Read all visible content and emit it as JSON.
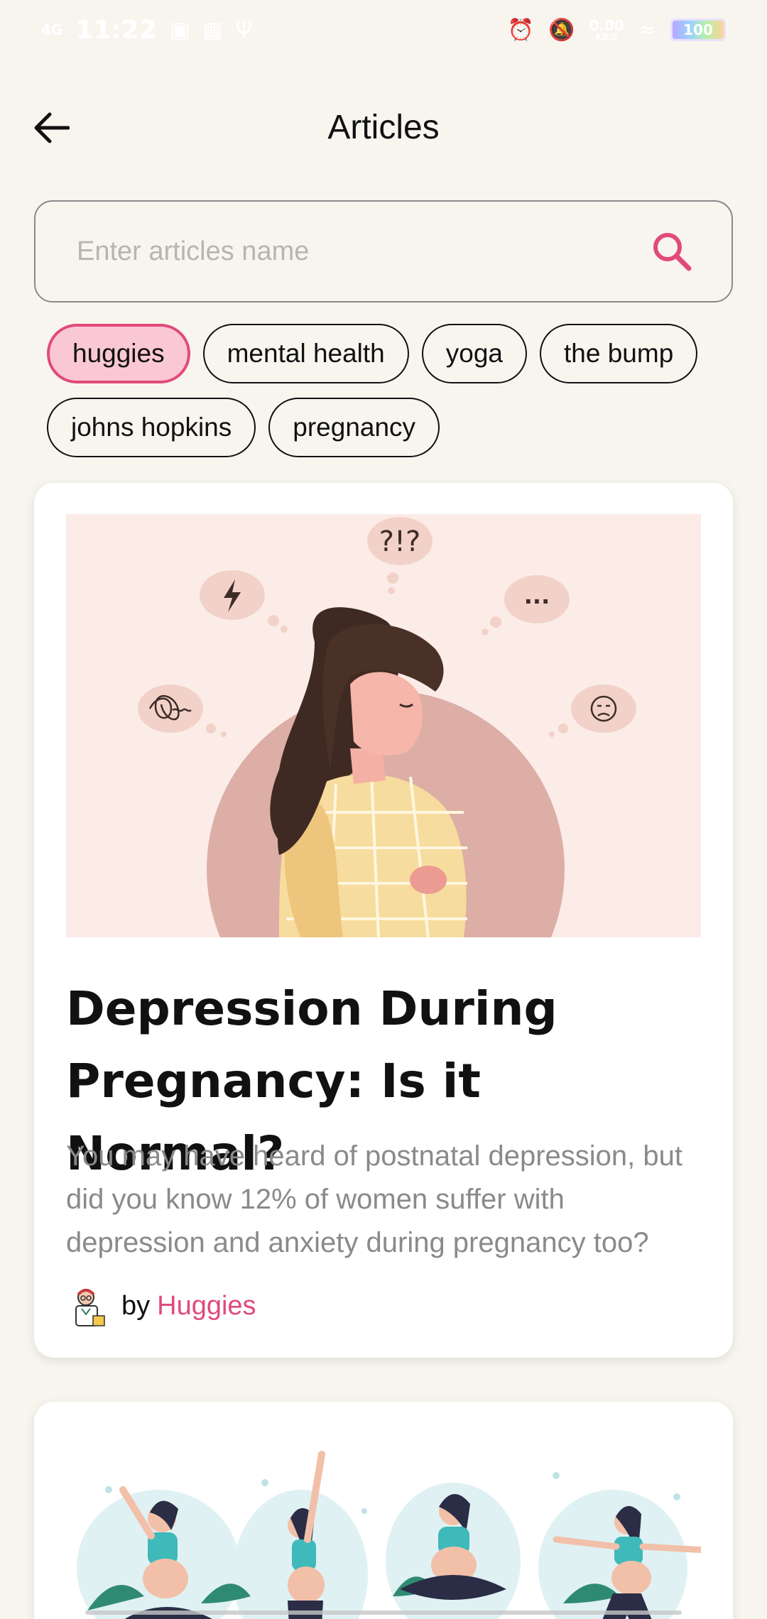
{
  "status_bar": {
    "network": "4G",
    "time": "11:22",
    "speed": "0.00",
    "speed_unit": "KB/S",
    "battery": "100"
  },
  "header": {
    "title": "Articles"
  },
  "search": {
    "placeholder": "Enter articles name",
    "value": ""
  },
  "chips": [
    {
      "label": "huggies",
      "active": true
    },
    {
      "label": "mental health",
      "active": false
    },
    {
      "label": "yoga",
      "active": false
    },
    {
      "label": "the bump",
      "active": false
    },
    {
      "label": "johns hopkins",
      "active": false
    },
    {
      "label": "pregnancy",
      "active": false
    }
  ],
  "articles": [
    {
      "title": "Depression During Pregnancy: Is it Normal?",
      "description": "You may have heard of postnatal depression, but did you know 12% of women suffer with depression and anxiety during pregnancy too?",
      "by": "by",
      "author": "Huggies",
      "image_bubbles": [
        "?!?",
        "..."
      ]
    }
  ],
  "colors": {
    "accent": "#e14a7a",
    "active_chip_bg": "#fac8d5",
    "background": "#f8f5ef",
    "card": "#ffffff"
  },
  "icons": {
    "back": "arrow-left-icon",
    "search": "search-icon"
  }
}
